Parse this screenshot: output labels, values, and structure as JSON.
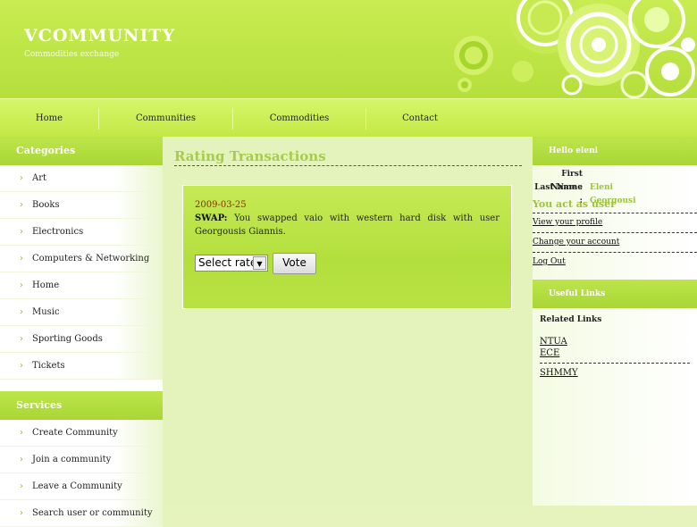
{
  "header": {
    "logo": "VCOMMUNITY",
    "tagline": "Commodities exchange"
  },
  "nav": [
    "Home",
    "Communities",
    "Commodities",
    "Contact"
  ],
  "categories": {
    "title": "Categories",
    "items": [
      "Art",
      "Books",
      "Electronics",
      "Computers & Networking",
      "Home",
      "Music",
      "Sporting Goods",
      "Tickets"
    ]
  },
  "services": {
    "title": "Services",
    "items": [
      "Create Community",
      "Join a community",
      "Leave a Community",
      "Search user or community"
    ]
  },
  "main": {
    "title": "Rating Transactions",
    "transaction": {
      "date": "2009-03-25",
      "type": "SWAP:",
      "text": "You swapped vaio with western hard disk with user Georgousis Giannis."
    },
    "rate_select": "Select rate",
    "vote_label": "Vote"
  },
  "user": {
    "greeting": "Hello eleni",
    "first_name_label": "First Name :",
    "first_name": "Eleni",
    "last_name_label": "Last Name :",
    "last_name": "Georgousi",
    "act_as": "You act as user",
    "links": [
      "View your profile",
      "Change your account",
      "Log Out"
    ]
  },
  "useful": {
    "title": "Useful Links",
    "related_title": "Related Links",
    "links": [
      "NTUA",
      "ECE",
      "SHMMY"
    ]
  },
  "colors": {
    "accent": "#b5df3c",
    "title_green": "#a8cc4a",
    "date_red": "#8a2a00"
  }
}
